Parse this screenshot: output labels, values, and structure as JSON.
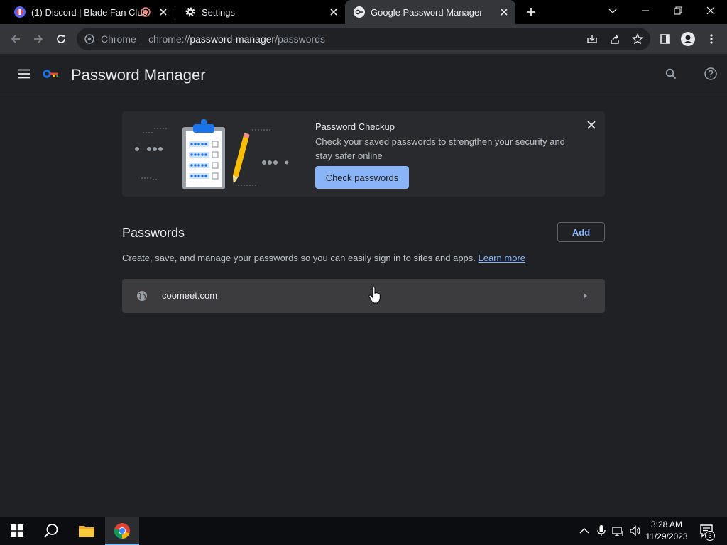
{
  "tabs": [
    {
      "title": "(1) Discord | Blade Fan Club",
      "active": false
    },
    {
      "title": "Settings",
      "active": false
    },
    {
      "title": "Google Password Manager",
      "active": true
    }
  ],
  "omnibox": {
    "site_label": "Chrome",
    "url_scheme": "chrome://",
    "url_host": "password-manager",
    "url_path": "/passwords"
  },
  "app": {
    "title": "Password Manager"
  },
  "checkup": {
    "title": "Password Checkup",
    "description": "Check your saved passwords to strengthen your security and stay safer online",
    "button_label": "Check passwords"
  },
  "passwords_section": {
    "title": "Passwords",
    "add_label": "Add",
    "description": "Create, save, and manage your passwords so you can easily sign in to sites and apps.",
    "learn_more": "Learn more",
    "items": [
      {
        "site": "coomeet.com"
      }
    ]
  },
  "taskbar": {
    "time": "3:28 AM",
    "date": "11/29/2023",
    "notifications": "3"
  },
  "colors": {
    "accent": "#8ab4f8",
    "background": "#202124",
    "surface": "#292a2d",
    "toolbar": "#35363a"
  }
}
